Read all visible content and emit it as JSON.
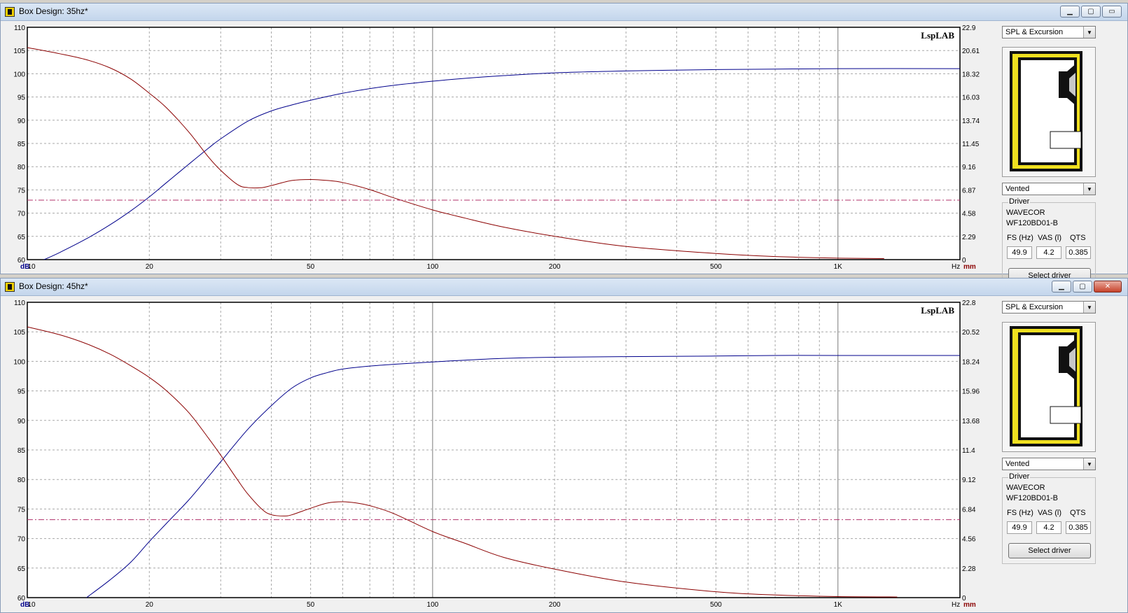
{
  "windows": [
    {
      "title": "Box Design: 35hz*",
      "response_type": "SPL & Excursion",
      "enclosure_type": "Vented",
      "driver_group_label": "Driver",
      "driver_make": "WAVECOR",
      "driver_model": "WF120BD01-B",
      "params_headers": [
        "FS (Hz)",
        "VAS (l)",
        "QTS"
      ],
      "params_values": [
        "49.9",
        "4.2",
        "0.385"
      ],
      "select_driver_label": "Select driver",
      "close_glyph": "▭",
      "chart_data": {
        "type": "line",
        "watermark": "LspLAB",
        "x_scale": "log",
        "xlim": [
          10,
          2000
        ],
        "x_ticks": [
          "10",
          "20",
          "50",
          "100",
          "200",
          "500",
          "1K"
        ],
        "x_unit": "Hz",
        "left_axis": {
          "label": "dB",
          "ylim": [
            60,
            110
          ],
          "ticks": [
            "110",
            "105",
            "100",
            "95",
            "90",
            "85",
            "80",
            "75",
            "70",
            "65",
            "60"
          ]
        },
        "right_axis": {
          "label": "mm",
          "ylim": [
            0,
            22.9
          ],
          "ticks": [
            "22.9",
            "20.61",
            "18.32",
            "16.03",
            "13.74",
            "11.45",
            "9.16",
            "6.87",
            "4.58",
            "2.29",
            "0"
          ]
        },
        "xmax_tick": "",
        "grid": true,
        "series": [
          {
            "axis": "left",
            "color": "#00008b",
            "x": [
              11,
              12,
              14,
              16,
              18,
              20,
              22,
              25,
              28,
              30,
              35,
              40,
              45,
              50,
              60,
              70,
              80,
              100,
              120,
              150,
              200,
              300,
              500,
              700,
              1000,
              2000
            ],
            "y": [
              60,
              61.5,
              64.5,
              67.5,
              70.5,
              73.5,
              76.5,
              80.5,
              84,
              86,
              89.8,
              92,
              93.3,
              94.3,
              95.8,
              96.8,
              97.5,
              98.4,
              99,
              99.6,
              100.2,
              100.6,
              100.9,
              101,
              101.1,
              101.1
            ]
          },
          {
            "axis": "right",
            "color": "#8b0000",
            "x": [
              10,
              12,
              14,
              16,
              18,
              20,
              22,
              25,
              28,
              30,
              33,
              35,
              38,
              40,
              45,
              50,
              55,
              60,
              70,
              80,
              100,
              120,
              150,
              200,
              300,
              500,
              700,
              1000,
              1300
            ],
            "y": [
              20.9,
              20.3,
              19.7,
              18.9,
              17.8,
              16.4,
              15,
              12.6,
              10.1,
              8.8,
              7.4,
              7.1,
              7.1,
              7.3,
              7.8,
              7.9,
              7.8,
              7.6,
              6.9,
              6.1,
              4.9,
              4.1,
              3.2,
              2.3,
              1.3,
              0.6,
              0.3,
              0.15,
              0.1
            ]
          },
          {
            "axis": "left",
            "color": "#b0306a",
            "style": "dashdot",
            "x": [
              10,
              2000
            ],
            "y": [
              72.8,
              72.8
            ]
          }
        ]
      }
    },
    {
      "title": "Box Design: 45hz*",
      "response_type": "SPL & Excursion",
      "enclosure_type": "Vented",
      "driver_group_label": "Driver",
      "driver_make": "WAVECOR",
      "driver_model": "WF120BD01-B",
      "params_headers": [
        "FS (Hz)",
        "VAS (l)",
        "QTS"
      ],
      "params_values": [
        "49.9",
        "4.2",
        "0.385"
      ],
      "select_driver_label": "Select driver",
      "close_glyph": "✕",
      "chart_data": {
        "type": "line",
        "watermark": "LspLAB",
        "x_scale": "log",
        "xlim": [
          10,
          2000
        ],
        "x_ticks": [
          "10",
          "20",
          "50",
          "100",
          "200",
          "500",
          "1K"
        ],
        "x_unit": "Hz",
        "left_axis": {
          "label": "dB",
          "ylim": [
            60,
            110
          ],
          "ticks": [
            "110",
            "105",
            "100",
            "95",
            "90",
            "85",
            "80",
            "75",
            "70",
            "65",
            "60"
          ]
        },
        "right_axis": {
          "label": "mm",
          "ylim": [
            0,
            22.8
          ],
          "ticks": [
            "22.8",
            "20.52",
            "18.24",
            "15.96",
            "13.68",
            "11.4",
            "9.12",
            "6.84",
            "4.56",
            "2.28",
            "0"
          ]
        },
        "grid": true,
        "series": [
          {
            "axis": "left",
            "color": "#00008b",
            "x": [
              14,
              16,
              18,
              20,
              22,
              25,
              28,
              30,
              35,
              40,
              45,
              50,
              55,
              60,
              70,
              80,
              100,
              120,
              150,
              200,
              300,
              500,
              700,
              1000,
              2000
            ],
            "y": [
              60,
              63,
              66,
              69.5,
              72.5,
              76.5,
              80.5,
              83,
              88.5,
              92.5,
              95.5,
              97.2,
              98.1,
              98.7,
              99.2,
              99.5,
              99.9,
              100.2,
              100.5,
              100.7,
              100.8,
              100.9,
              101,
              101,
              101
            ]
          },
          {
            "axis": "right",
            "color": "#8b0000",
            "x": [
              10,
              12,
              14,
              16,
              18,
              20,
              22,
              25,
              28,
              30,
              33,
              35,
              38,
              40,
              43,
              45,
              50,
              55,
              60,
              65,
              70,
              80,
              100,
              120,
              150,
              200,
              300,
              500,
              700,
              1000,
              1400
            ],
            "y": [
              20.9,
              20.3,
              19.6,
              18.8,
              17.9,
              17,
              16,
              14.3,
              12.3,
              11,
              9.1,
              8,
              6.8,
              6.4,
              6.3,
              6.4,
              6.9,
              7.3,
              7.4,
              7.3,
              7.1,
              6.5,
              5.1,
              4.2,
              3.1,
              2.2,
              1.2,
              0.45,
              0.2,
              0.08,
              0.05
            ]
          },
          {
            "axis": "left",
            "color": "#b0306a",
            "style": "dashdot",
            "x": [
              10,
              2000
            ],
            "y": [
              73.2,
              73.2
            ]
          }
        ]
      }
    }
  ]
}
